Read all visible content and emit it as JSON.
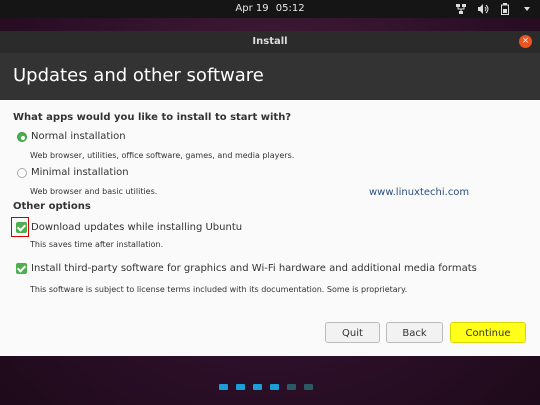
{
  "topbar": {
    "date": "Apr 19",
    "time": "05:12",
    "icons": [
      "network-icon",
      "volume-icon",
      "battery-icon",
      "menu-caret-icon"
    ]
  },
  "window": {
    "title": "Install",
    "close_label": "×"
  },
  "header": {
    "title": "Updates and other software"
  },
  "main": {
    "question": "What apps would you like to install to start with?",
    "options": [
      {
        "label": "Normal installation",
        "desc": "Web browser, utilities, office software, games, and media players.",
        "selected": true
      },
      {
        "label": "Minimal installation",
        "desc": "Web browser and basic utilities.",
        "selected": false
      }
    ],
    "other_heading": "Other options",
    "checks": [
      {
        "label": "Download updates while installing Ubuntu",
        "desc": "This saves time after installation.",
        "checked": true
      },
      {
        "label": "Install third-party software for graphics and Wi-Fi hardware and additional media formats",
        "desc": "This software is subject to license terms included with its documentation. Some is proprietary.",
        "checked": true
      }
    ],
    "watermark": "www.linuxtechi.com"
  },
  "buttons": {
    "quit": "Quit",
    "back": "Back",
    "continue": "Continue"
  },
  "progress": {
    "dots_total": 6,
    "dots_done": 4,
    "colors": {
      "done": "#19a0d6",
      "todo": "#2b5a66"
    }
  },
  "colors": {
    "accent": "#4caf50",
    "close": "#e95420",
    "continue_bg": "#ffff1a",
    "highlight": "#d00000"
  }
}
